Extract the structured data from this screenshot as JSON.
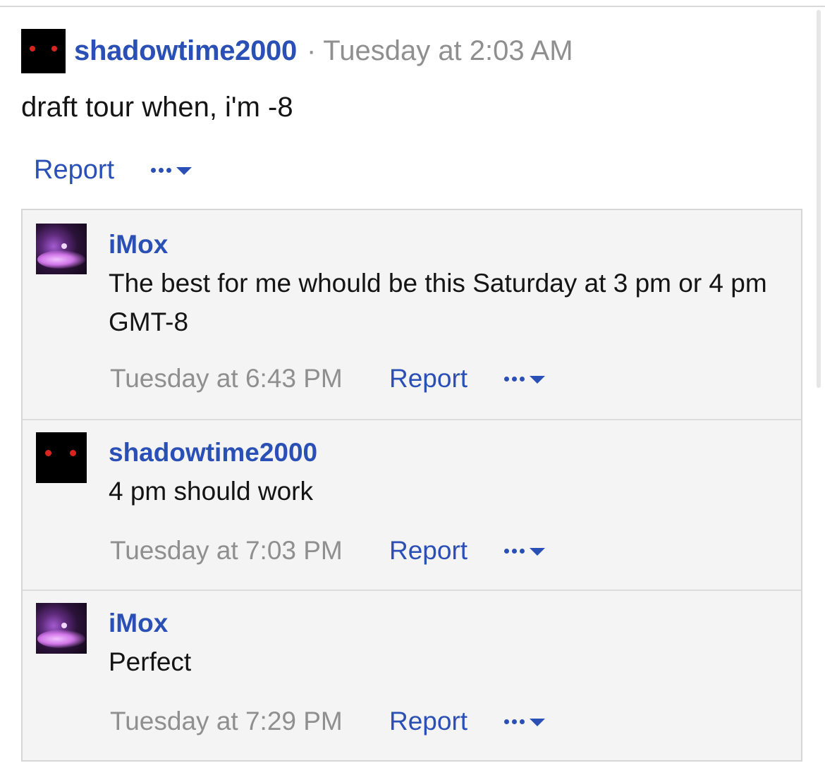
{
  "post": {
    "username": "shadowtime2000",
    "separator": "·",
    "timestamp": "Tuesday at 2:03 AM",
    "text": "draft tour when, i'm -8",
    "report_label": "Report",
    "avatar_icon": "red-eyes-avatar",
    "more_icon": "more-options-icon"
  },
  "comments": [
    {
      "username": "iMox",
      "text": "The best for me whould be this Saturday at 3 pm or 4 pm GMT-8",
      "timestamp": "Tuesday at 6:43 PM",
      "report_label": "Report",
      "avatar_icon": "purple-orb-avatar"
    },
    {
      "username": "shadowtime2000",
      "text": "4 pm should work",
      "timestamp": "Tuesday at 7:03 PM",
      "report_label": "Report",
      "avatar_icon": "red-eyes-avatar"
    },
    {
      "username": "iMox",
      "text": "Perfect",
      "timestamp": "Tuesday at 7:29 PM",
      "report_label": "Report",
      "avatar_icon": "purple-orb-avatar"
    }
  ],
  "colors": {
    "link": "#2a4fb5",
    "muted": "#8f8f8f",
    "text": "#141414",
    "comment_bg": "#f4f4f4",
    "border": "#d6d6d6"
  }
}
